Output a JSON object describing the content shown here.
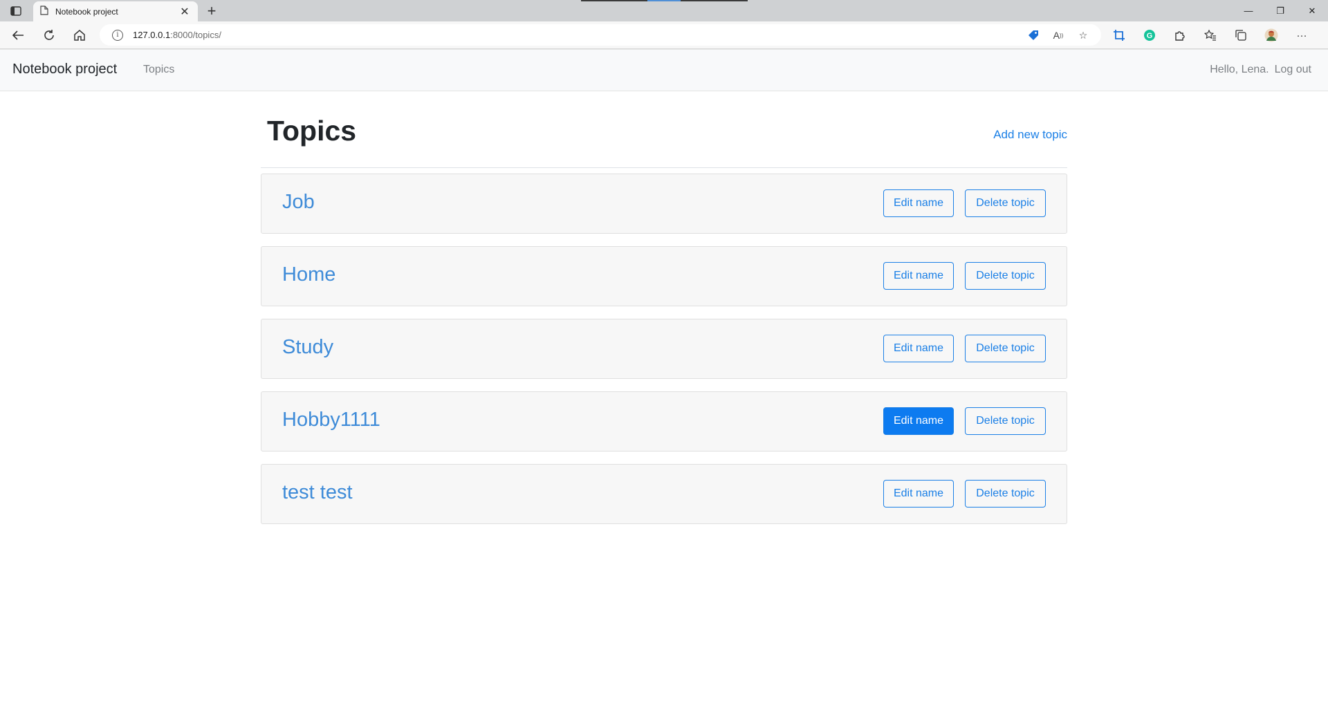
{
  "browser": {
    "tab_title": "Notebook project",
    "url_host": "127.0.0.1",
    "url_path": ":8000/topics/"
  },
  "navbar": {
    "brand": "Notebook project",
    "topics_link": "Topics",
    "greeting": "Hello, Lena.",
    "logout": "Log out"
  },
  "page": {
    "title": "Topics",
    "add_link": "Add new topic"
  },
  "buttons": {
    "edit_label": "Edit name",
    "delete_label": "Delete topic"
  },
  "topics": [
    {
      "name": "Job",
      "edit_active": false
    },
    {
      "name": "Home",
      "edit_active": false
    },
    {
      "name": "Study",
      "edit_active": false
    },
    {
      "name": "Hobby1111",
      "edit_active": true
    },
    {
      "name": "test test",
      "edit_active": false
    }
  ],
  "colors": {
    "accent": "#1a7fe6",
    "topic_link": "#3e8bd8",
    "card_bg": "#f7f7f7"
  }
}
